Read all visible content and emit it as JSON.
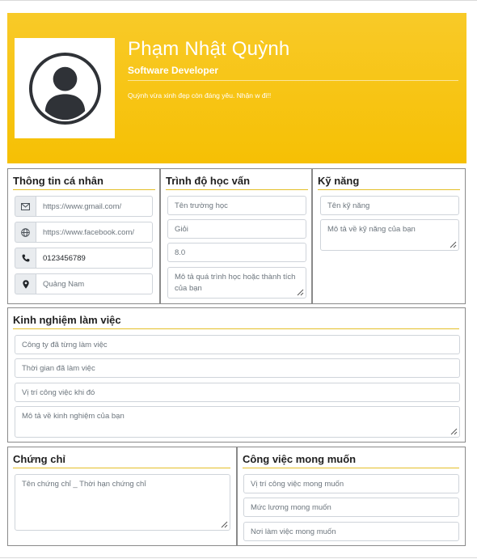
{
  "profile": {
    "name": "Phạm Nhật Quỳnh",
    "job_title": "Software Developer",
    "bio": "Quỳnh vừa xinh đẹp còn đáng yêu. Nhận w đi!!"
  },
  "personal": {
    "title": "Thông tin cá nhân",
    "email": "https://www.gmail.com/",
    "website": "https://www.facebook.com/",
    "phone": "0123456789",
    "location": "Quảng Nam",
    "icons": [
      "envelope-icon",
      "globe-icon",
      "phone-icon",
      "location-pin-icon"
    ]
  },
  "education": {
    "title": "Trình độ học vấn",
    "school_placeholder": "Tên trường học",
    "rank": "Giỏi",
    "score": "8.0",
    "desc_placeholder": "Mô tả quá trình học hoặc thành tích của bạn"
  },
  "skills": {
    "title": "Kỹ năng",
    "name_placeholder": "Tên kỹ năng",
    "desc_placeholder": "Mô tả về kỹ năng của bạn"
  },
  "experience": {
    "title": "Kinh nghiệm làm việc",
    "company_placeholder": "Công ty đã từng làm việc",
    "time_placeholder": "Thời gian đã làm việc",
    "position_placeholder": "Vị trí công việc khi đó",
    "desc_placeholder": "Mô tả về kinh nghiệm của bạn"
  },
  "certificates": {
    "title": "Chứng chỉ",
    "desc_placeholder": "Tên chứng chỉ _ Thời hạn chứng chỉ"
  },
  "desired_job": {
    "title": "Công việc mong muốn",
    "position_placeholder": "Vị trí công việc mong muốn",
    "salary_placeholder": "Mức lương mong muốn",
    "location_placeholder": "Nơi làm việc mong muốn"
  },
  "colors": {
    "header": "#f6c004",
    "accent_line": "#e4bf28",
    "border": "#8a8a8a"
  }
}
